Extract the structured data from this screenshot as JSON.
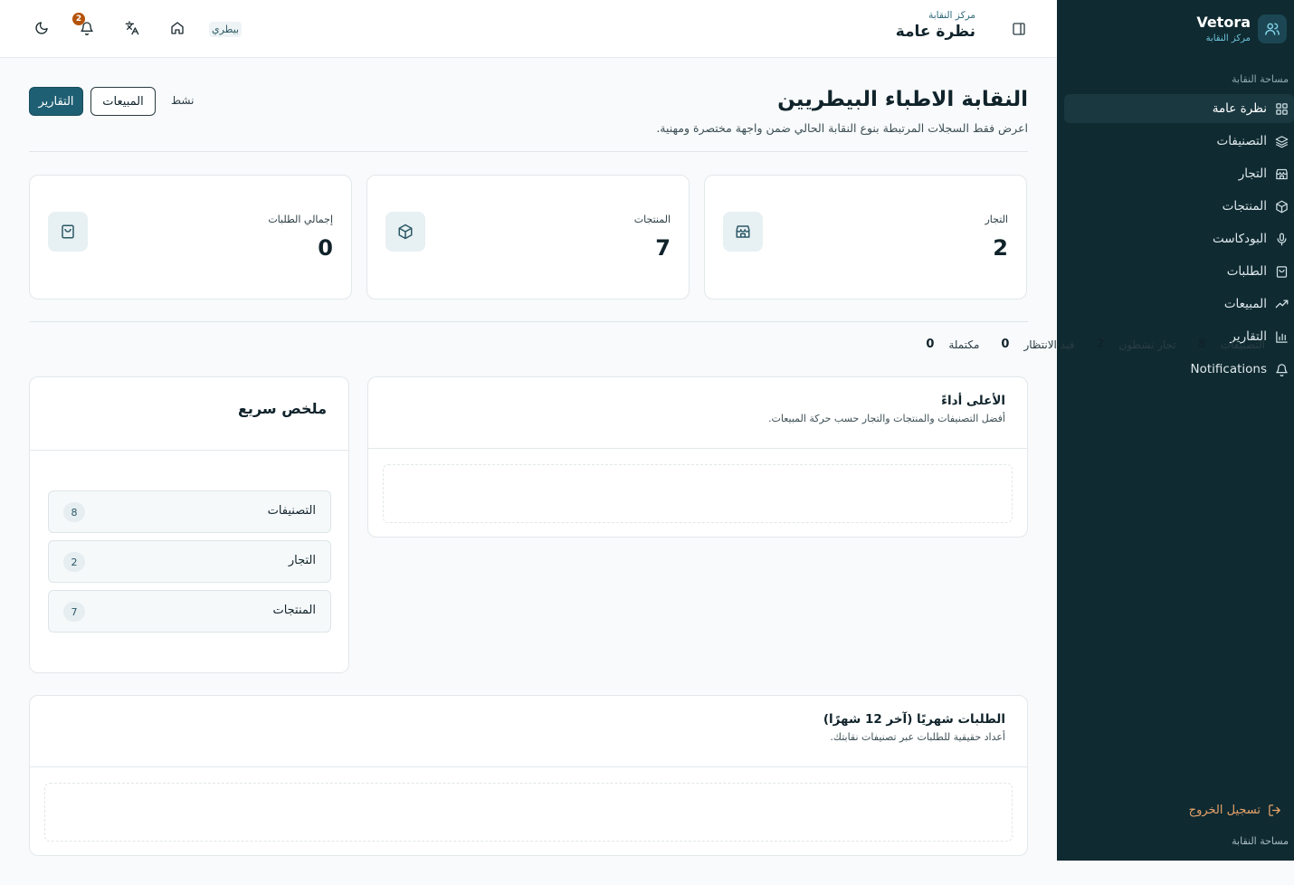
{
  "sidebar": {
    "brand_title": "Vetora",
    "brand_subtitle": "مركز النقابة",
    "section_label": "مساحة النقابة",
    "items": [
      {
        "label": "نظرة عامة",
        "icon": "grid-icon",
        "active": true
      },
      {
        "label": "التصنيفات",
        "icon": "layers-icon"
      },
      {
        "label": "التجار",
        "icon": "store-icon"
      },
      {
        "label": "المنتجات",
        "icon": "package-icon"
      },
      {
        "label": "البودكاست",
        "icon": "mic-icon"
      },
      {
        "label": "الطلبات",
        "icon": "shopping-bag-icon"
      },
      {
        "label": "المبيعات",
        "icon": "trending-up-icon"
      },
      {
        "label": "التقارير",
        "icon": "bar-chart-icon"
      },
      {
        "label": "Notifications",
        "icon": "bell-icon"
      }
    ],
    "logout_label": "تسجيل الخروج",
    "footer_label": "مساحة النقابة"
  },
  "topbar": {
    "breadcrumb": "مركز النقابة",
    "page_title": "نظرة عامة",
    "language_label": "بيطري",
    "notification_count": "2"
  },
  "header": {
    "title": "النقابة الاطباء البيطريين",
    "description": "اعرض فقط السجلات المرتبطة بنوع النقابة الحالي ضمن واجهة مختصرة ومهنية.",
    "reports_button": "التقارير",
    "sales_button": "المبيعات",
    "status": "نشط"
  },
  "stats": [
    {
      "label": "التجار",
      "value": "2",
      "icon": "store-icon"
    },
    {
      "label": "المنتجات",
      "value": "7",
      "icon": "package-icon"
    },
    {
      "label": "إجمالي الطلبات",
      "value": "0",
      "icon": "shopping-bag-icon"
    }
  ],
  "metrics": [
    {
      "label": "التصنيفات",
      "value": "8"
    },
    {
      "label": "تجار نشطون",
      "value": "2"
    },
    {
      "label": "قيد الانتظار",
      "value": "0"
    },
    {
      "label": "مكتملة",
      "value": "0"
    }
  ],
  "top_performers": {
    "title": "الأعلى أداءً",
    "subtitle": "أفضل التصنيفات والمنتجات والتجار حسب حركة المبيعات."
  },
  "quick_summary": {
    "title": "ملخص سريع",
    "rows": [
      {
        "label": "التصنيفات",
        "count": "8"
      },
      {
        "label": "التجار",
        "count": "2"
      },
      {
        "label": "المنتجات",
        "count": "7"
      }
    ]
  },
  "monthly_orders": {
    "title": "الطلبات شهريًا (آخر 12 شهرًا)",
    "subtitle": "أعداد حقيقية للطلبات عبر تصنيفات نقابتك."
  },
  "colors": {
    "sidebar_bg": "#0f2a31",
    "primary": "#1f5f73",
    "badge": "#b45309",
    "logout": "#e8a36a"
  }
}
